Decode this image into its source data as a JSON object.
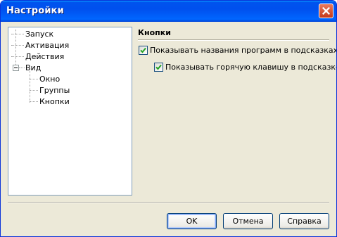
{
  "window": {
    "title": "Настройки"
  },
  "tree": {
    "items": [
      {
        "label": "Запуск"
      },
      {
        "label": "Активация"
      },
      {
        "label": "Действия"
      },
      {
        "label": "Вид",
        "expanded": true,
        "children": [
          {
            "label": "Окно"
          },
          {
            "label": "Группы"
          },
          {
            "label": "Кнопки"
          }
        ]
      }
    ]
  },
  "panel": {
    "title": "Кнопки",
    "options": [
      {
        "label": "Показывать названия программ в подсказках",
        "checked": true
      },
      {
        "label": "Показывать горячую клавишу в подсказке",
        "checked": true
      }
    ]
  },
  "buttons": {
    "ok": "OK",
    "cancel": "Отмена",
    "help": "Справка"
  },
  "colors": {
    "titlebar": "#0053ee",
    "dialog_bg": "#ece9d8",
    "close": "#c4391a",
    "check": "#21a121"
  }
}
